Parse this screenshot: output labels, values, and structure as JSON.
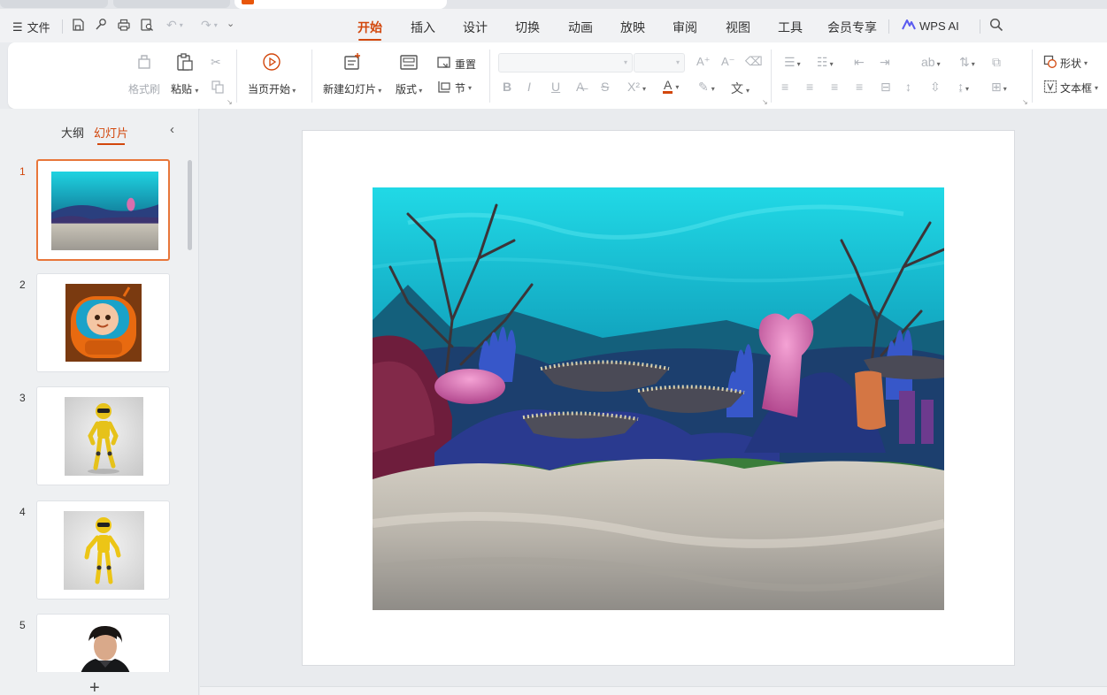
{
  "menu": {
    "file_label": "文件",
    "tabs": [
      {
        "label": "开始",
        "active": true
      },
      {
        "label": "插入",
        "active": false
      },
      {
        "label": "设计",
        "active": false
      },
      {
        "label": "切换",
        "active": false
      },
      {
        "label": "动画",
        "active": false
      },
      {
        "label": "放映",
        "active": false
      },
      {
        "label": "审阅",
        "active": false
      },
      {
        "label": "视图",
        "active": false
      },
      {
        "label": "工具",
        "active": false
      },
      {
        "label": "会员专享",
        "active": false
      }
    ],
    "wps_ai_label": "WPS AI"
  },
  "ribbon": {
    "format_painter": "格式刷",
    "paste": "粘贴",
    "play_from_current": "当页开始",
    "new_slide": "新建幻灯片",
    "layout": "版式",
    "reset": "重置",
    "section": "节",
    "shape": "形状",
    "textbox": "文本框",
    "font_name": "",
    "font_size": ""
  },
  "left_panel": {
    "tab_outline": "大纲",
    "tab_slides": "幻灯片",
    "slides": [
      {
        "number": "1",
        "content": "ocean-scene",
        "active": true
      },
      {
        "number": "2",
        "content": "orange-robot",
        "active": false
      },
      {
        "number": "3",
        "content": "yellow-robot",
        "active": false
      },
      {
        "number": "4",
        "content": "yellow-robot",
        "active": false
      },
      {
        "number": "5",
        "content": "portrait-photo",
        "active": false
      }
    ],
    "add_symbol": "+"
  },
  "colors": {
    "accent": "#d2470c",
    "selected_border": "#e8763a"
  }
}
